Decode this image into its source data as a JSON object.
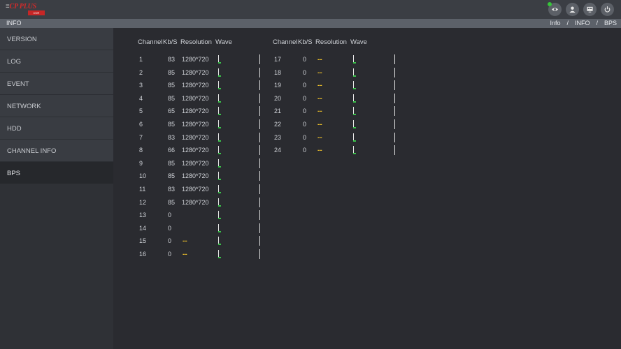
{
  "brand": {
    "name": "CP PLUS",
    "sub": "DVR"
  },
  "topbar": {
    "icons": [
      "eye-icon",
      "user-icon",
      "display-icon",
      "power-icon"
    ]
  },
  "page": {
    "title": "INFO",
    "breadcrumb": [
      "Info",
      "/",
      "INFO",
      "/",
      "BPS"
    ]
  },
  "sidebar": {
    "items": [
      {
        "label": "VERSION"
      },
      {
        "label": "LOG"
      },
      {
        "label": "EVENT"
      },
      {
        "label": "NETWORK"
      },
      {
        "label": "HDD"
      },
      {
        "label": "CHANNEL INFO"
      },
      {
        "label": "BPS",
        "active": true
      }
    ]
  },
  "table": {
    "headers": [
      "Channel",
      "Kb/S",
      "Resolution",
      "Wave"
    ],
    "left": [
      {
        "ch": "1",
        "kbps": "83",
        "res": "1280*720"
      },
      {
        "ch": "2",
        "kbps": "85",
        "res": "1280*720"
      },
      {
        "ch": "3",
        "kbps": "85",
        "res": "1280*720"
      },
      {
        "ch": "4",
        "kbps": "85",
        "res": "1280*720"
      },
      {
        "ch": "5",
        "kbps": "65",
        "res": "1280*720"
      },
      {
        "ch": "6",
        "kbps": "85",
        "res": "1280*720"
      },
      {
        "ch": "7",
        "kbps": "83",
        "res": "1280*720"
      },
      {
        "ch": "8",
        "kbps": "66",
        "res": "1280*720"
      },
      {
        "ch": "9",
        "kbps": "85",
        "res": "1280*720"
      },
      {
        "ch": "10",
        "kbps": "85",
        "res": "1280*720"
      },
      {
        "ch": "11",
        "kbps": "83",
        "res": "1280*720"
      },
      {
        "ch": "12",
        "kbps": "85",
        "res": "1280*720"
      },
      {
        "ch": "13",
        "kbps": "0",
        "res": ""
      },
      {
        "ch": "14",
        "kbps": "0",
        "res": ""
      },
      {
        "ch": "15",
        "kbps": "0",
        "res": "--"
      },
      {
        "ch": "16",
        "kbps": "0",
        "res": "--"
      }
    ],
    "right": [
      {
        "ch": "17",
        "kbps": "0",
        "res": "--"
      },
      {
        "ch": "18",
        "kbps": "0",
        "res": "--"
      },
      {
        "ch": "19",
        "kbps": "0",
        "res": "--"
      },
      {
        "ch": "20",
        "kbps": "0",
        "res": "--"
      },
      {
        "ch": "21",
        "kbps": "0",
        "res": "--"
      },
      {
        "ch": "22",
        "kbps": "0",
        "res": "--"
      },
      {
        "ch": "23",
        "kbps": "0",
        "res": "--"
      },
      {
        "ch": "24",
        "kbps": "0",
        "res": "--"
      }
    ]
  },
  "colors": {
    "dash": "#f0c22a",
    "wave_green": "#3ac24a",
    "online": "#37c53a"
  }
}
